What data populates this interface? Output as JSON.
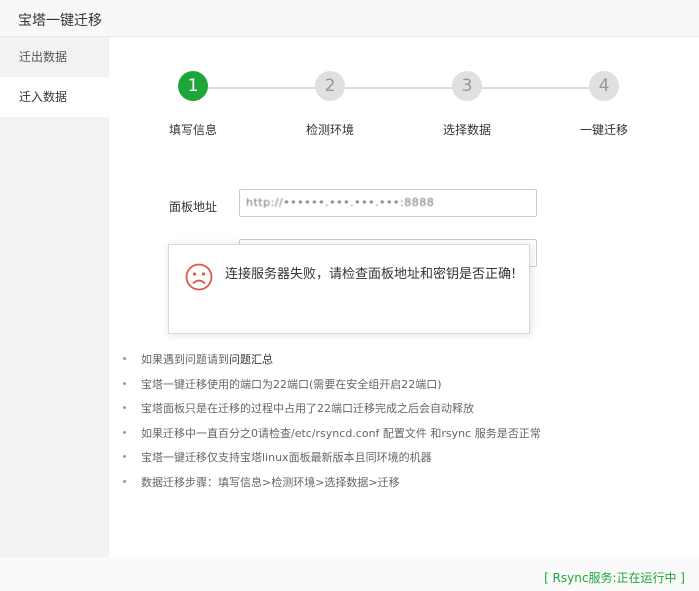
{
  "window": {
    "title": "宝塔一键迁移"
  },
  "sidebar": {
    "items": [
      {
        "label": "迁出数据",
        "active": false
      },
      {
        "label": "迁入数据",
        "active": true
      }
    ]
  },
  "steps": [
    {
      "number": "1",
      "label": "填写信息",
      "active": true
    },
    {
      "number": "2",
      "label": "检测环境",
      "active": false
    },
    {
      "number": "3",
      "label": "选择数据",
      "active": false
    },
    {
      "number": "4",
      "label": "一键迁移",
      "active": false
    }
  ],
  "form": {
    "panel_address_label": "面板地址",
    "panel_address_value": "http://••••••.•••.•••.•••:8888",
    "second_field_value": ""
  },
  "dialog": {
    "icon": "sad-face-icon",
    "message": "连接服务器失败，请检查面板地址和密钥是否正确!"
  },
  "tips": {
    "item1_prefix": "如果遇到问题请到",
    "item1_link": "问题汇总",
    "item2": "宝塔一键迁移使用的端口为22端口(需要在安全组开启22端口)",
    "item3": "宝塔面板只是在迁移的过程中占用了22端口迁移完成之后会自动释放",
    "item4": "如果迁移中一直百分之0请检查/etc/rsyncd.conf 配置文件 和rsync 服务是否正常",
    "item5": "宝塔一键迁移仅支持宝塔linux面板最新版本且同环境的机器",
    "item6": "数据迁移步骤：填写信息>检测环境>选择数据>迁移"
  },
  "status": {
    "text": "[ Rsync服务:正在运行中 ]",
    "color": "#20a53a"
  },
  "colors": {
    "accent": "#20a53a",
    "inactive_step": "#e0e0e0",
    "error_icon": "#e0564a"
  }
}
